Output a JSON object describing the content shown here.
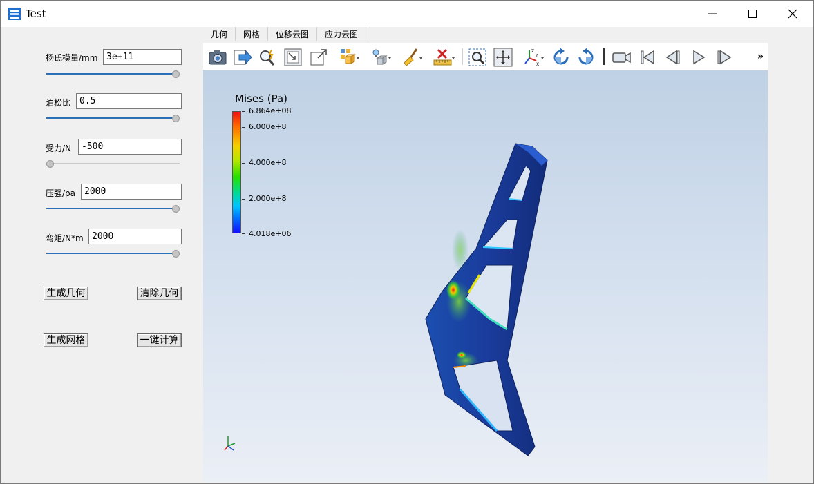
{
  "window": {
    "title": "Test"
  },
  "params": [
    {
      "label": "杨氏模量/mm",
      "value": "3e+11",
      "slider_fraction": 1.0
    },
    {
      "label": "泊松比",
      "value": "0.5",
      "slider_fraction": 1.0
    },
    {
      "label": "受力/N",
      "value": "-500",
      "slider_fraction": 0.0
    },
    {
      "label": "压强/pa",
      "value": "2000",
      "slider_fraction": 1.0
    },
    {
      "label": "弯矩/N*m",
      "value": "2000",
      "slider_fraction": 1.0
    }
  ],
  "buttons": {
    "generate_geometry": "生成几何",
    "clear_geometry": "清除几何",
    "generate_mesh": "生成网格",
    "one_click_compute": "一键计算"
  },
  "tabs": [
    "几何",
    "网格",
    "位移云图",
    "应力云图"
  ],
  "toolbar": {
    "icons": [
      "camera-icon",
      "export-icon",
      "zoom-probe-icon",
      "reset-view-icon",
      "maximize-icon",
      "representation-dropdown-icon",
      "light-dropdown-icon",
      "clear-brush-icon",
      "delete-ruler-icon",
      "zoom-box-icon",
      "pan-icon",
      "axes-orientation-icon",
      "rotate-cw-icon",
      "rotate-ccw-icon",
      "video-camera-icon",
      "first-frame-icon",
      "previous-frame-icon",
      "play-icon",
      "next-frame-icon"
    ],
    "overflow": "»"
  },
  "colorbar": {
    "title": "Mises (Pa)",
    "labels": [
      "6.864e+08",
      "6.000e+8",
      "4.000e+8",
      "2.000e+8",
      "4.018e+06"
    ],
    "colors": {
      "max": "#ee1010",
      "mid": "#26e000",
      "min": "#1010ff"
    }
  },
  "colors": {
    "accent": "#2a6fb8",
    "viewport_top": "#bfd1e5",
    "viewport_bottom": "#ebeff6",
    "model_base": "#1a3fa0"
  }
}
